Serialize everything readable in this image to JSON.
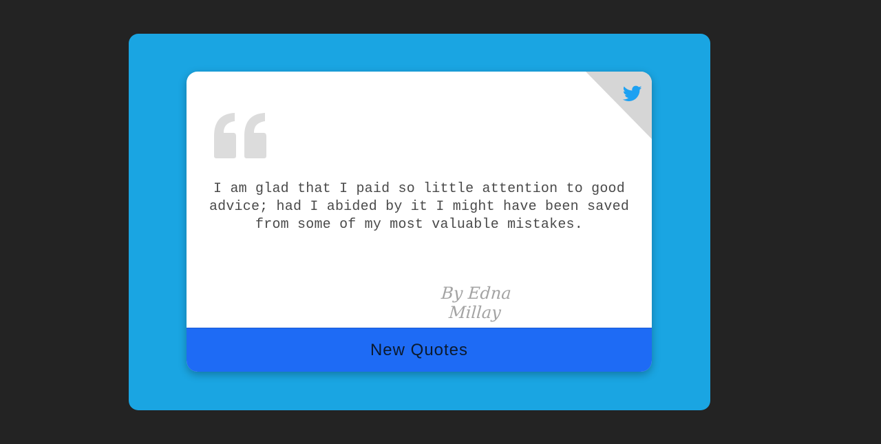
{
  "quote": {
    "text": "I am glad that I paid so little attention to good advice; had I abided by it I might have been saved from some of my most valuable mistakes.",
    "author": "By Edna Millay"
  },
  "actions": {
    "new_quote_label": "New Quotes"
  },
  "icons": {
    "share": "twitter-icon",
    "quote": "quote-mark-icon"
  },
  "colors": {
    "page_background": "#232323",
    "frame": "#1aa5e2",
    "card": "#ffffff",
    "button": "#1e6bf5",
    "twitter": "#1da1f2",
    "quote_mark": "#dcdcdc",
    "corner_fold": "#d6d6d6"
  }
}
